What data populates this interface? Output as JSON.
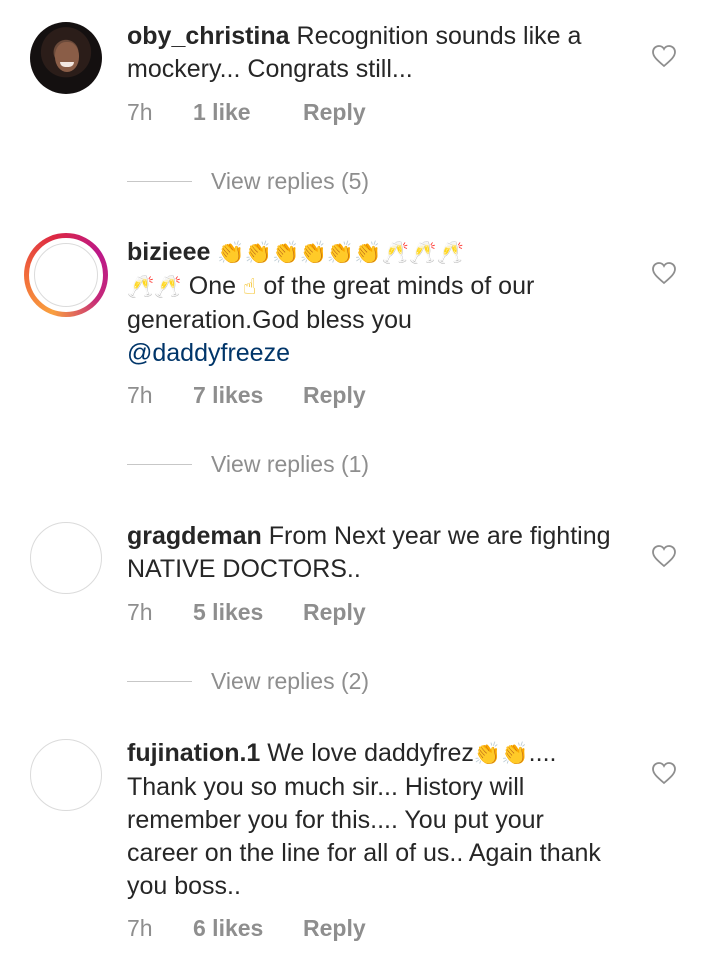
{
  "comments": [
    {
      "username": "oby_christina",
      "text": "Recognition sounds like a mockery... Congrats still...",
      "time": "7h",
      "likes": "1 like",
      "reply": "Reply",
      "avatar": "photo"
    },
    {
      "username": "bizieee",
      "text_line1_emojis": "👏👏👏👏👏👏🥂🥂🥂",
      "text_line2_prefix_emojis": "🥂🥂",
      "text_part_a": "One",
      "text_emoji_finger": "☝",
      "text_part_b": "of the great minds of our generation.God bless you",
      "mention": "@daddyfreeze",
      "time": "7h",
      "likes": "7 likes",
      "reply": "Reply",
      "avatar": "story-ring"
    },
    {
      "username": "gragdeman",
      "text": "From Next year we are fighting NATIVE DOCTORS..",
      "time": "7h",
      "likes": "5 likes",
      "reply": "Reply",
      "avatar": "empty"
    },
    {
      "username": "fujination.1",
      "text_a": "We love daddyfrez",
      "text_emojis": "👏👏",
      "text_b": "....",
      "text_c": "Thank you so much sir... History will remember you for this.... You put your career on the line for all of us.. Again thank you boss..",
      "time": "7h",
      "likes": "6 likes",
      "reply": "Reply",
      "avatar": "empty"
    }
  ],
  "view_replies": [
    "View replies (5)",
    "View replies (1)",
    "View replies (2)"
  ],
  "icons": {
    "like": "heart-outline-icon",
    "clap": "clapping-hands-icon",
    "cheers": "clinking-glasses-icon",
    "finger": "index-pointing-up-icon"
  },
  "colors": {
    "text": "#262626",
    "secondary": "#8e8e8e",
    "mention": "#003569"
  }
}
